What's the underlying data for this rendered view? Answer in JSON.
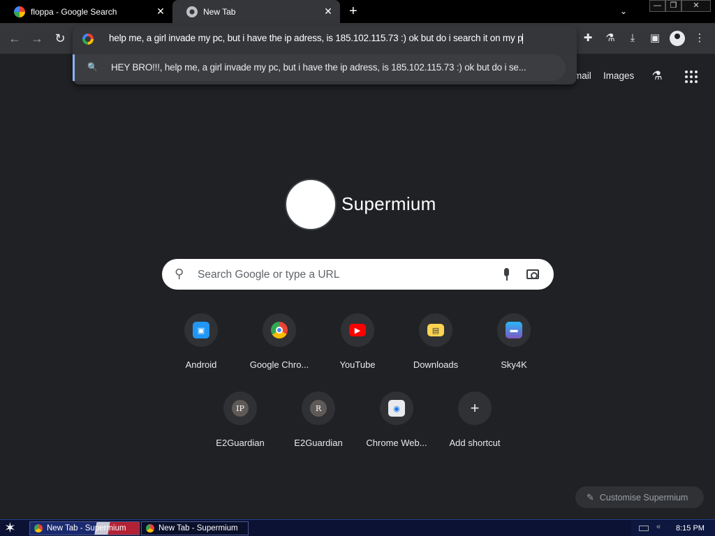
{
  "tabs": [
    {
      "title": "floppa - Google Search",
      "close": "✕"
    },
    {
      "title": "New Tab",
      "close": "✕"
    }
  ],
  "new_tab_symbol": "+",
  "tab_search_symbol": "⌄",
  "window_controls": {
    "minimize": "—",
    "restore": "❐",
    "close": "✕"
  },
  "toolbar": {
    "back": "←",
    "forward": "→",
    "reload": "↻"
  },
  "omnibox": {
    "input_text": "help me, a girl invade my pc, but i have the ip adress, is 185.102.115.73 :) ok but do i search it on my p",
    "suggestion": "HEY BRO!!!, help me, a girl invade my pc, but i have the ip adress, is 185.102.115.73 :) ok but do i se..."
  },
  "toolbar_icons": [
    "puzzle-icon",
    "flask-icon",
    "download-icon",
    "side-panel-icon",
    "profile-icon",
    "kebab-menu-icon"
  ],
  "top_links": {
    "gmail": "mail",
    "images": "Images"
  },
  "logo_text": "Supermium",
  "search": {
    "placeholder": "Search Google or type a URL"
  },
  "shortcuts": [
    {
      "label": "Android",
      "icon": "android-icon",
      "color": "#2196f3"
    },
    {
      "label": "Google Chro...",
      "icon": "chrome-icon",
      "color": "#4285f4"
    },
    {
      "label": "YouTube",
      "icon": "youtube-icon",
      "color": "#ff0000"
    },
    {
      "label": "Downloads",
      "icon": "downloads-icon",
      "color": "#ffd54f"
    },
    {
      "label": "Sky4K",
      "icon": "sky4k-icon",
      "color": "#29b6f6"
    },
    {
      "label": "E2Guardian",
      "icon": "letter-ip-icon",
      "letter": "IP"
    },
    {
      "label": "E2Guardian",
      "icon": "letter-r-icon",
      "letter": "R"
    },
    {
      "label": "Chrome Web...",
      "icon": "chrome-web-store-icon",
      "color": "#1a73e8"
    },
    {
      "label": "Add shortcut",
      "icon": "plus-icon",
      "letter": "+"
    }
  ],
  "customise": "Customise Supermium",
  "taskbar": {
    "items": [
      "New Tab - Supermium",
      "New Tab - Supermium"
    ],
    "clock": "8:15 PM"
  }
}
